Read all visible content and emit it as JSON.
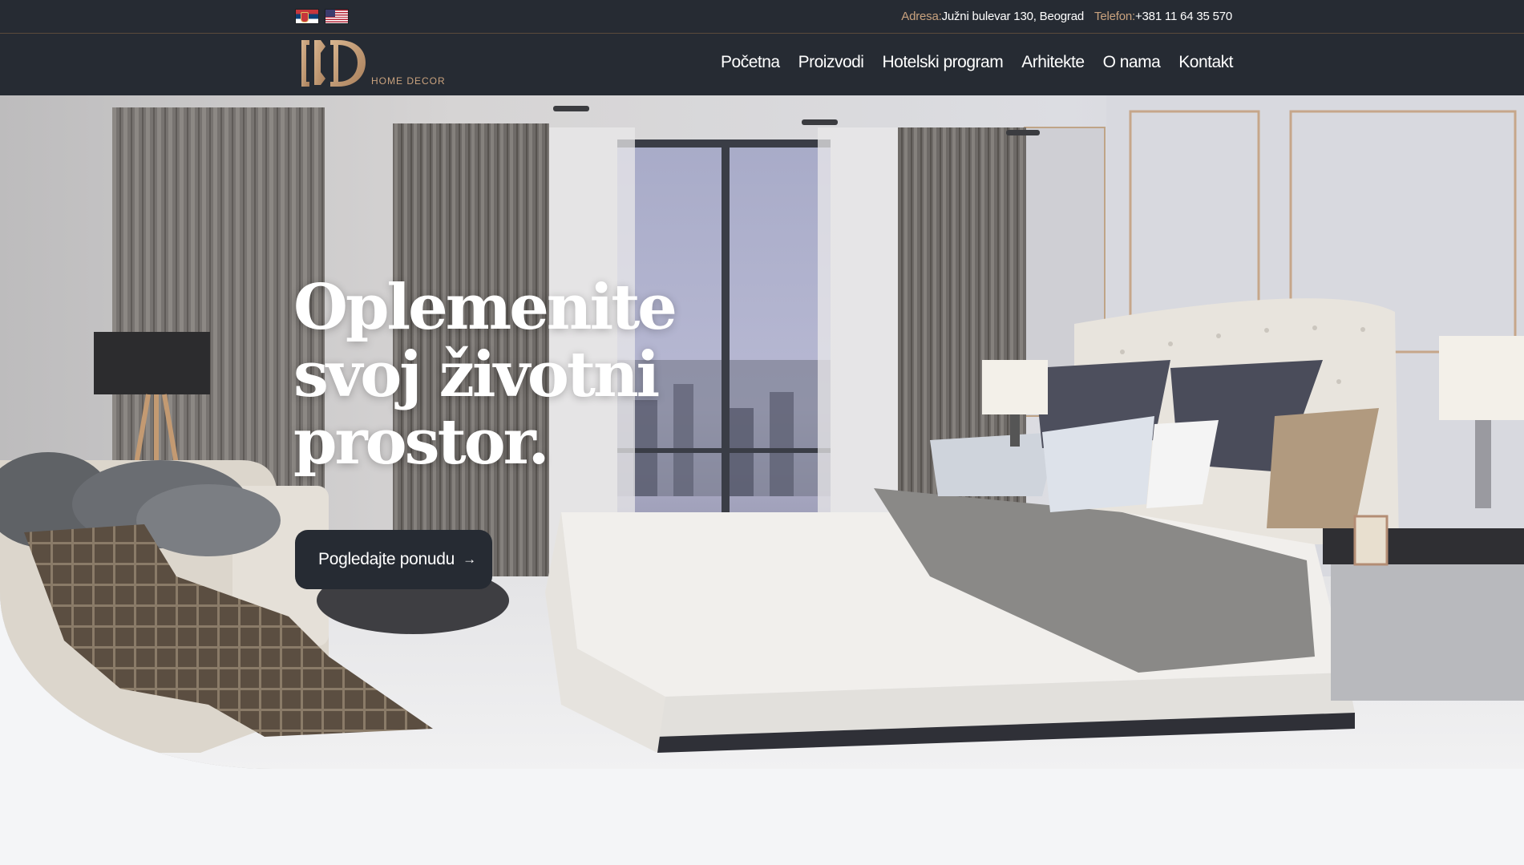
{
  "topbar": {
    "flags": [
      {
        "name": "serbian-flag-icon",
        "label": "Srpski"
      },
      {
        "name": "us-flag-icon",
        "label": "English"
      }
    ],
    "address_label": "Adresa:",
    "address_value": "Južni bulevar 130, Beograd",
    "phone_label": "Telefon:",
    "phone_value": "+381 11 64 35 570"
  },
  "header": {
    "logo_tagline": "HOME DECOR",
    "nav": [
      "Početna",
      "Proizvodi",
      "Hotelski program",
      "Arhitekte",
      "O nama",
      "Kontakt"
    ]
  },
  "hero": {
    "headline": [
      "Oplemenite",
      "svoj životni",
      "prostor."
    ],
    "cta_label": "Pogledajte ponudu",
    "cta_icon": "arrow-right-icon"
  },
  "colors": {
    "dark": "#262b33",
    "gold": "#c9a27e",
    "page_bg": "#f4f5f7"
  }
}
